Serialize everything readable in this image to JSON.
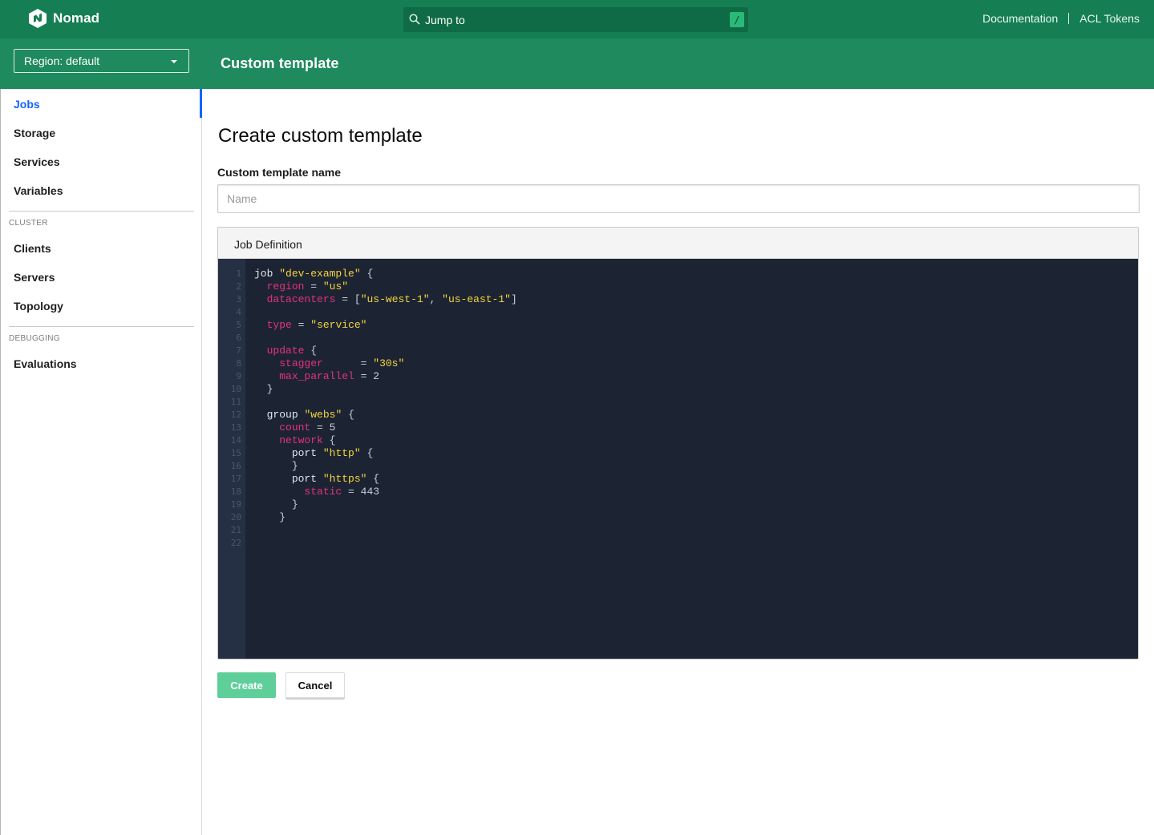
{
  "navbar": {
    "brand": "Nomad",
    "search_placeholder": "Jump to",
    "search_shortcut": "/",
    "links": [
      "Documentation",
      "ACL Tokens"
    ]
  },
  "subnav": {
    "region": "Region: default",
    "title": "Custom template"
  },
  "sidebar": {
    "items": [
      {
        "label": "Jobs",
        "active": true
      },
      {
        "label": "Storage"
      },
      {
        "label": "Services"
      },
      {
        "label": "Variables"
      }
    ],
    "cluster_heading": "CLUSTER",
    "cluster_items": [
      {
        "label": "Clients"
      },
      {
        "label": "Servers"
      },
      {
        "label": "Topology"
      }
    ],
    "debugging_heading": "DEBUGGING",
    "debugging_items": [
      {
        "label": "Evaluations"
      }
    ]
  },
  "main": {
    "title": "Create custom template",
    "name_label": "Custom template name",
    "name_placeholder": "Name",
    "editor_title": "Job Definition",
    "line_numbers": [
      "1",
      "2",
      "3",
      "4",
      "5",
      "6",
      "7",
      "8",
      "9",
      "10",
      "11",
      "12",
      "13",
      "14",
      "15",
      "16",
      "17",
      "18",
      "19",
      "20",
      "21",
      "22"
    ],
    "code_lines": [
      "job \"dev-example\" {",
      "  region = \"us\"",
      "  datacenters = [\"us-west-1\", \"us-east-1\"]",
      "",
      "  type = \"service\"",
      "",
      "  update {",
      "    stagger      = \"30s\"",
      "    max_parallel = 2",
      "  }",
      "",
      "  group \"webs\" {",
      "    count = 5",
      "    network {",
      "      port \"http\" {",
      "      }",
      "      port \"https\" {",
      "        static = 443",
      "      }",
      "    }",
      "",
      ""
    ],
    "create_label": "Create",
    "cancel_label": "Cancel"
  },
  "colors": {
    "navbar": "#157f53",
    "subnav": "#1f8a5d",
    "active_link": "#1563ff",
    "editor_bg": "#1c2433",
    "string": "#f5d33c",
    "attribute": "#e6317e",
    "create_button": "#5fcf9a"
  }
}
